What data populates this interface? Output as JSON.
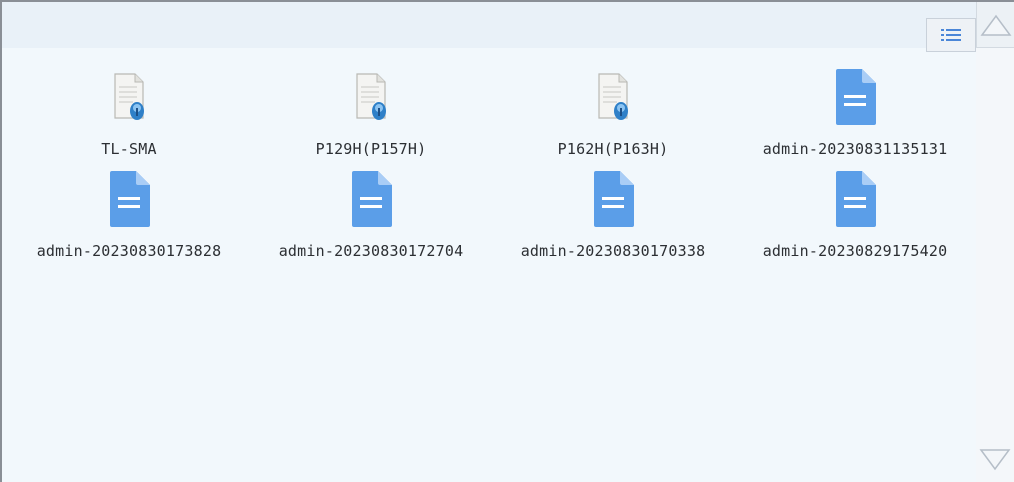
{
  "toolbar": {
    "view_toggle_icon": "list-view-icon"
  },
  "scrollbar": {
    "up_icon": "scroll-up-arrow-icon",
    "down_icon": "scroll-down-arrow-icon"
  },
  "files": [
    {
      "name": "TL-SMA",
      "icon": "disk-document-icon"
    },
    {
      "name": "P129H(P157H)",
      "icon": "disk-document-icon"
    },
    {
      "name": "P162H(P163H)",
      "icon": "disk-document-icon"
    },
    {
      "name": "admin-20230831135131",
      "icon": "text-document-icon"
    },
    {
      "name": "admin-20230830173828",
      "icon": "text-document-icon"
    },
    {
      "name": "admin-20230830172704",
      "icon": "text-document-icon"
    },
    {
      "name": "admin-20230830170338",
      "icon": "text-document-icon"
    },
    {
      "name": "admin-20230829175420",
      "icon": "text-document-icon"
    }
  ],
  "colors": {
    "doc_blue": "#5b9ee8",
    "doc_fold": "#a9cdf6",
    "background": "#f2f8fc"
  }
}
